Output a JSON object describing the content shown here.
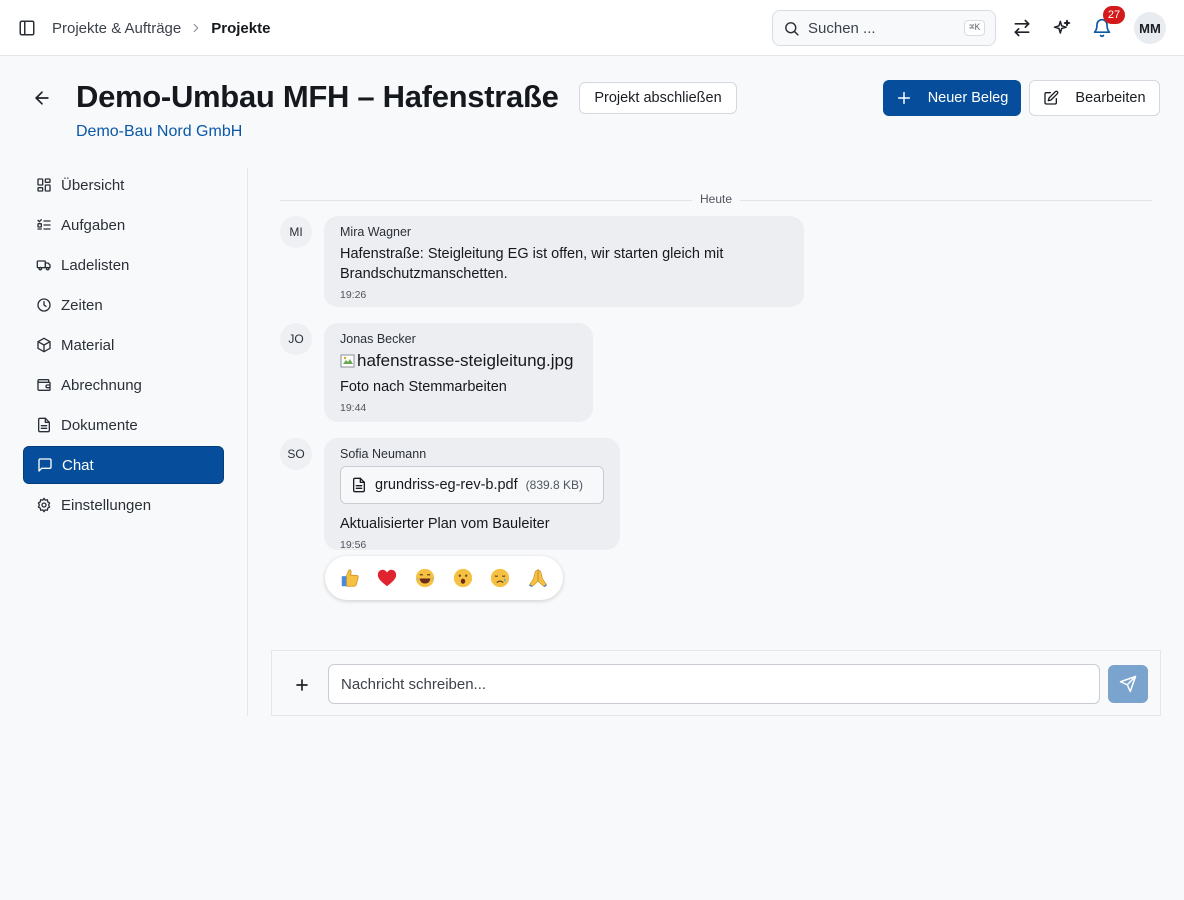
{
  "topbar": {
    "breadcrumb": {
      "parent": "Projekte & Aufträge",
      "separator": "›",
      "current": "Projekte"
    },
    "search": {
      "placeholder": "Suchen ...",
      "shortcut": "⌘K"
    },
    "notifications_count": "27",
    "user_initials": "MM"
  },
  "header": {
    "title": "Demo-Umbau MFH – Hafenstraße",
    "close_project_label": "Projekt abschließen",
    "new_document_label": "Neuer Beleg",
    "edit_label": "Bearbeiten",
    "customer": "Demo-Bau Nord GmbH"
  },
  "sidebar": {
    "items": [
      {
        "label": "Übersicht",
        "icon": "dashboard-icon",
        "active": false
      },
      {
        "label": "Aufgaben",
        "icon": "list-check-icon",
        "active": false
      },
      {
        "label": "Ladelisten",
        "icon": "truck-icon",
        "active": false
      },
      {
        "label": "Zeiten",
        "icon": "clock-icon",
        "active": false
      },
      {
        "label": "Material",
        "icon": "package-icon",
        "active": false
      },
      {
        "label": "Abrechnung",
        "icon": "wallet-icon",
        "active": false
      },
      {
        "label": "Dokumente",
        "icon": "document-icon",
        "active": false
      },
      {
        "label": "Chat",
        "icon": "chat-icon",
        "active": true
      },
      {
        "label": "Einstellungen",
        "icon": "gear-icon",
        "active": false
      }
    ]
  },
  "chat": {
    "day_label": "Heute",
    "messages": [
      {
        "initials": "MI",
        "author": "Mira Wagner",
        "text": "Hafenstraße: Steigleitung EG ist offen, wir starten gleich mit Brandschutzmanschetten.",
        "time": "19:26"
      },
      {
        "initials": "JO",
        "author": "Jonas Becker",
        "image_alt": "hafenstrasse-steigleitung.jpg",
        "text": "Foto nach Stemmarbeiten",
        "time": "19:44"
      },
      {
        "initials": "SO",
        "author": "Sofia Neumann",
        "file_name": "grundriss-eg-rev-b.pdf",
        "file_size": "(839.8 KB)",
        "text": "Aktualisierter Plan vom Bauleiter",
        "time": "19:56"
      }
    ],
    "reactions": [
      "👍",
      "❤️",
      "😂",
      "😮",
      "😢",
      "🙏"
    ]
  },
  "composer": {
    "placeholder": "Nachricht schreiben..."
  },
  "colors": {
    "primary": "#064e9b",
    "link": "#0b58a6",
    "badge": "#d31b1b",
    "send_disabled": "#7aa3cd"
  }
}
